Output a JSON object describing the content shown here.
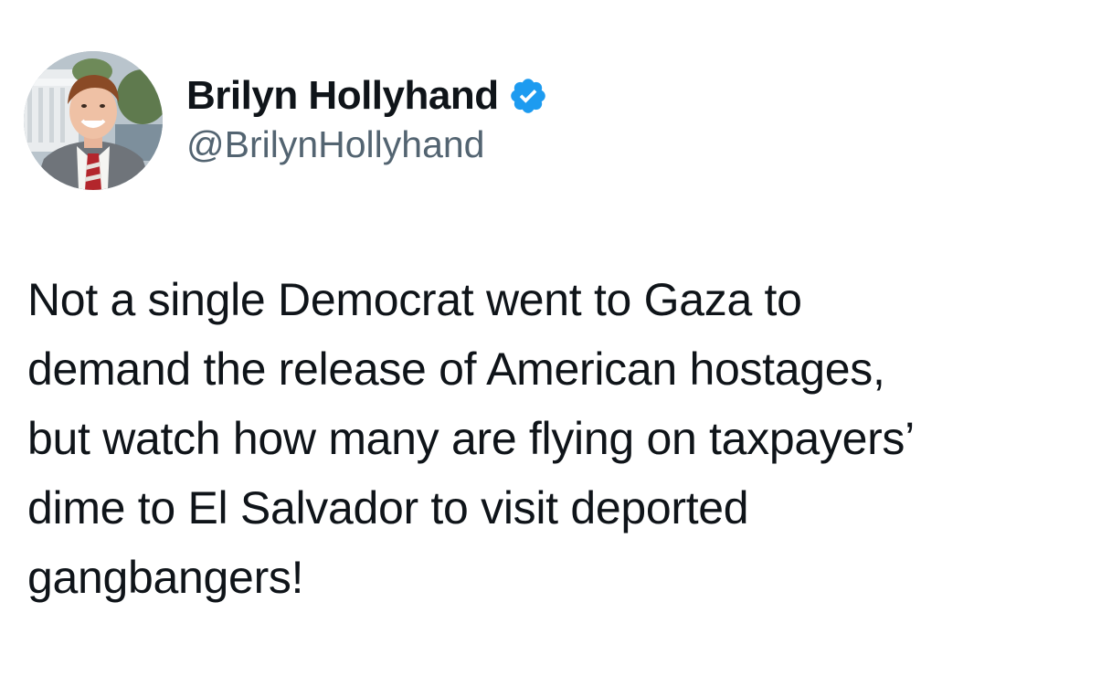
{
  "author": {
    "display_name": "Brilyn Hollyhand",
    "handle": "@BrilynHollyhand",
    "verified": true,
    "verified_badge_color": "#1d9bf0",
    "avatar_icon": "profile-photo"
  },
  "tweet": {
    "text": "Not a single Democrat went to Gaza to\ndemand the release of American hostages,\nbut watch how many are flying on taxpayers’\ndime to El Salvador to visit deported\ngangbangers!"
  },
  "colors": {
    "text_primary": "#0f1419",
    "text_secondary": "#536471",
    "background": "#ffffff"
  }
}
